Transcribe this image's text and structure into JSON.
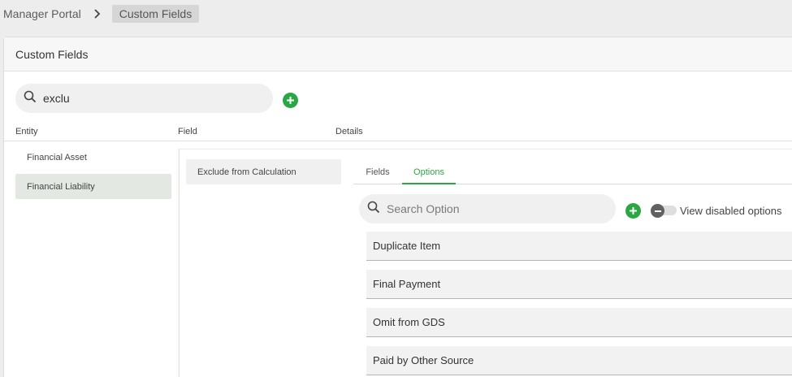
{
  "breadcrumb": {
    "root": "Manager Portal",
    "current": "Custom Fields"
  },
  "card": {
    "title": "Custom Fields"
  },
  "search": {
    "value": "exclu"
  },
  "columns": {
    "entity": "Entity",
    "field": "Field",
    "details": "Details"
  },
  "entities": [
    {
      "label": "Financial Asset",
      "selected": false
    },
    {
      "label": "Financial Liability",
      "selected": true
    }
  ],
  "fields": [
    {
      "label": "Exclude from Calculation",
      "selected": true
    }
  ],
  "tabs": [
    {
      "label": "Fields",
      "active": false
    },
    {
      "label": "Options",
      "active": true
    }
  ],
  "option_search": {
    "placeholder": "Search Option"
  },
  "view_disabled": {
    "label": "View disabled options",
    "enabled": false
  },
  "options": [
    {
      "label": "Duplicate Item"
    },
    {
      "label": "Final Payment"
    },
    {
      "label": "Omit from GDS"
    },
    {
      "label": "Paid by Other Source"
    }
  ],
  "colors": {
    "accent": "#2aa744",
    "selected_bg": "#e3e8e3",
    "toggle_knob": "#616161"
  },
  "icons": {
    "breadcrumb_sep": "chevron-right-icon",
    "search": "search-icon",
    "add": "plus-icon",
    "toggle": "minus-icon"
  }
}
